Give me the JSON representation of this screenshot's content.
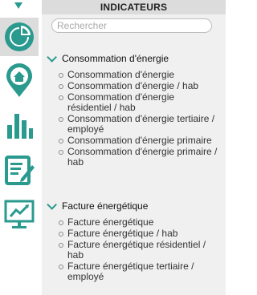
{
  "header": {
    "title": "INDICATEURS"
  },
  "search": {
    "placeholder": "Rechercher",
    "value": ""
  },
  "sidebar": {
    "items": [
      {
        "name": "pie-chart",
        "active": true
      },
      {
        "name": "home-pin",
        "active": false
      },
      {
        "name": "bar-chart",
        "active": false
      },
      {
        "name": "document-edit",
        "active": false
      },
      {
        "name": "monitor-chart",
        "active": false
      }
    ]
  },
  "sections": [
    {
      "title": "Consommation d'énergie",
      "items": [
        "Consommation d'énergie",
        "Consommation d'énergie / hab",
        "Consommation d'énergie résidentiel / hab",
        "Consommation d'énergie tertiaire / employé",
        "Consommation d'énergie primaire",
        "Consommation d'énergie primaire / hab"
      ]
    },
    {
      "title": "Facture énergétique",
      "items": [
        "Facture énergétique",
        "Facture énergétique / hab",
        "Facture énergétique résidentiel / hab",
        "Facture énergétique tertiaire / employé"
      ]
    }
  ],
  "colors": {
    "accent": "#2a9a8f",
    "panel": "#f0f0f0",
    "header": "#dcdcdc"
  }
}
